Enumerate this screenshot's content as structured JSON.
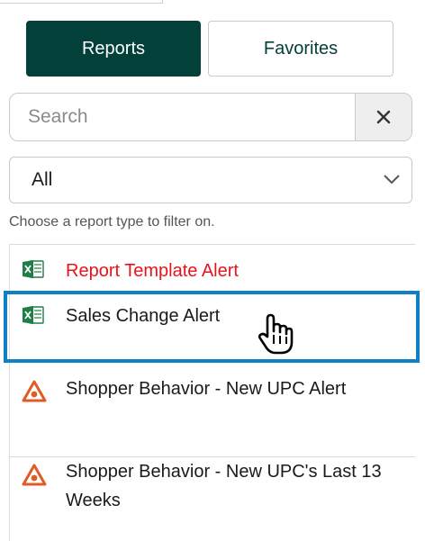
{
  "tabs": {
    "reports": "Reports",
    "favorites": "Favorites"
  },
  "search": {
    "placeholder": "Search",
    "value": ""
  },
  "filter": {
    "selected": "All",
    "hint": "Choose a report type to filter on."
  },
  "reports": [
    {
      "label": "Report Template Alert",
      "icon": "excel-icon"
    },
    {
      "label": "Sales Change Alert",
      "icon": "excel-icon"
    },
    {
      "label": "Shopper Behavior - New UPC Alert",
      "icon": "warning-icon"
    },
    {
      "label": "Shopper Behavior - New UPC's Last 13 Weeks",
      "icon": "warning-icon"
    }
  ],
  "colors": {
    "primary": "#03403a",
    "alert_text": "#e8141c",
    "highlight": "#0d80c6",
    "excel_green": "#1e7e45",
    "warning_orange": "#e05c24"
  }
}
